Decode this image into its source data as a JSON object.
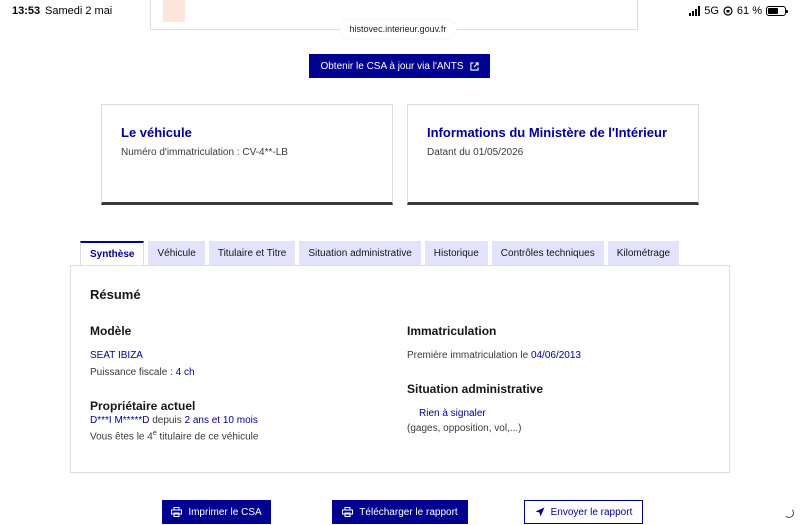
{
  "status_bar": {
    "time": "13:53",
    "date": "Samedi 2 mai",
    "network": "5G",
    "battery": "61 %",
    "battery_level": 0.61
  },
  "browser": {
    "url": "histovec.interieur.gouv.fr"
  },
  "ants_button": {
    "label": "Obtenir le CSA à jour via l'ANTS",
    "icon": "external-link-icon"
  },
  "vehicle_card": {
    "title": "Le véhicule",
    "plate": "Numéro d'immatriculation : CV-4**-LB"
  },
  "ministry_card": {
    "title": "Informations du Ministère de l'Intérieur",
    "date": "Datant du 01/05/2026"
  },
  "tabs": [
    {
      "label": "Synthèse",
      "active": true
    },
    {
      "label": "Véhicule",
      "active": false
    },
    {
      "label": "Titulaire et Titre",
      "active": false
    },
    {
      "label": "Situation administrative",
      "active": false
    },
    {
      "label": "Historique",
      "active": false
    },
    {
      "label": "Contrôles techniques",
      "active": false
    },
    {
      "label": "Kilométrage",
      "active": false
    }
  ],
  "summary": {
    "title": "Résumé",
    "model": {
      "heading": "Modèle",
      "name": "SEAT IBIZA",
      "power_label": "Puissance fiscale : ",
      "power_value": "4 ch"
    },
    "owner": {
      "heading": "Propriétaire actuel",
      "name": "D***I M*****D",
      "since_label": " depuis ",
      "since_value": "2 ans et 10 mois",
      "rank_prefix": "Vous êtes le ",
      "rank_number": "4",
      "rank_suffix": "e",
      "rank_rest": " titulaire de ce véhicule"
    },
    "registration": {
      "heading": "Immatriculation",
      "label": "Première immatriculation le ",
      "date": "04/06/2013"
    },
    "admin": {
      "heading": "Situation administrative",
      "status": "Rien à signaler",
      "details": "(gages, opposition, vol,...)"
    }
  },
  "actions": {
    "print": {
      "label": "Imprimer le CSA",
      "icon": "printer-icon"
    },
    "download": {
      "label": "Télécharger le rapport",
      "icon": "printer-icon"
    },
    "send": {
      "label": "Envoyer le rapport",
      "icon": "send-icon"
    }
  },
  "colors": {
    "primary": "#000091",
    "tab_background": "#e3e3fd",
    "border": "#dddddd"
  }
}
